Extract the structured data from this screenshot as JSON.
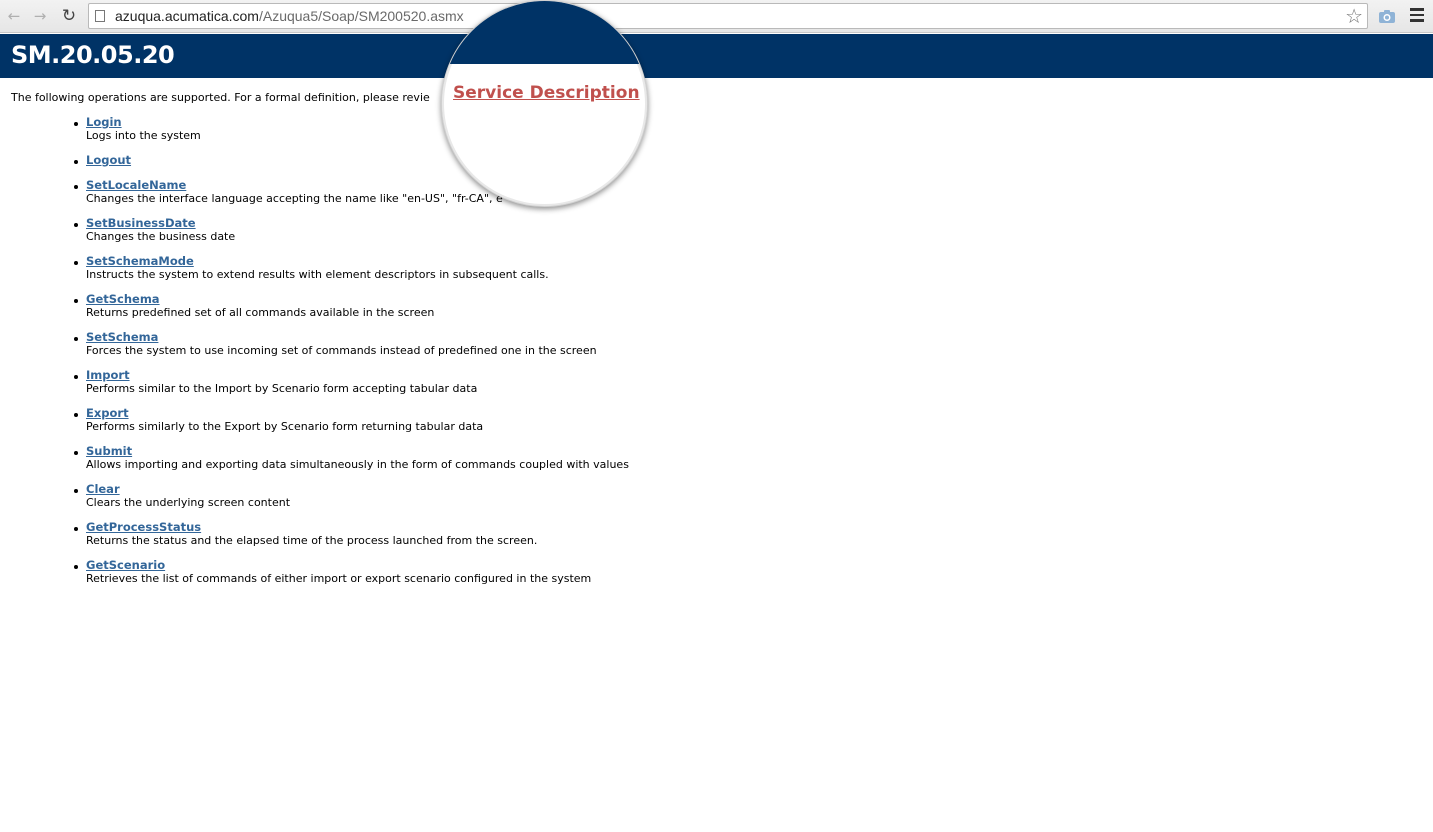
{
  "browser": {
    "url_host": "azuqua.acumatica.com",
    "url_path": "/Azuqua5/Soap/SM200520.asmx",
    "back_icon": "back-arrow-icon",
    "forward_icon": "forward-arrow-icon",
    "reload_icon": "reload-icon",
    "bookmark_icon": "star-icon",
    "screenshot_icon": "camera-icon",
    "menu_icon": "hamburger-menu-icon"
  },
  "page": {
    "title": "SM.20.05.20",
    "intro": "The following operations are supported. For a formal definition, please revie",
    "service_description_link": "Service Description",
    "header_color": "#003366",
    "link_color": "#336699",
    "magnified_link_color": "#c0504d"
  },
  "operations": [
    {
      "name": "Login",
      "desc": "Logs into the system"
    },
    {
      "name": "Logout",
      "desc": ""
    },
    {
      "name": "SetLocaleName",
      "desc": "Changes the interface language accepting the name like \"en-US\", \"fr-CA\", e"
    },
    {
      "name": "SetBusinessDate",
      "desc": "Changes the business date"
    },
    {
      "name": "SetSchemaMode",
      "desc": "Instructs the system to extend results with element descriptors in subsequent calls."
    },
    {
      "name": "GetSchema",
      "desc": "Returns predefined set of all commands available in the screen"
    },
    {
      "name": "SetSchema",
      "desc": "Forces the system to use incoming set of commands instead of predefined one in the screen"
    },
    {
      "name": "Import",
      "desc": "Performs similar to the Import by Scenario form accepting tabular data"
    },
    {
      "name": "Export",
      "desc": "Performs similarly to the Export by Scenario form returning tabular data"
    },
    {
      "name": "Submit",
      "desc": "Allows importing and exporting data simultaneously in the form of commands coupled with values"
    },
    {
      "name": "Clear",
      "desc": "Clears the underlying screen content"
    },
    {
      "name": "GetProcessStatus",
      "desc": "Returns the status and the elapsed time of the process launched from the screen."
    },
    {
      "name": "GetScenario",
      "desc": "Retrieves the list of commands of either import or export scenario configured in the system"
    }
  ]
}
